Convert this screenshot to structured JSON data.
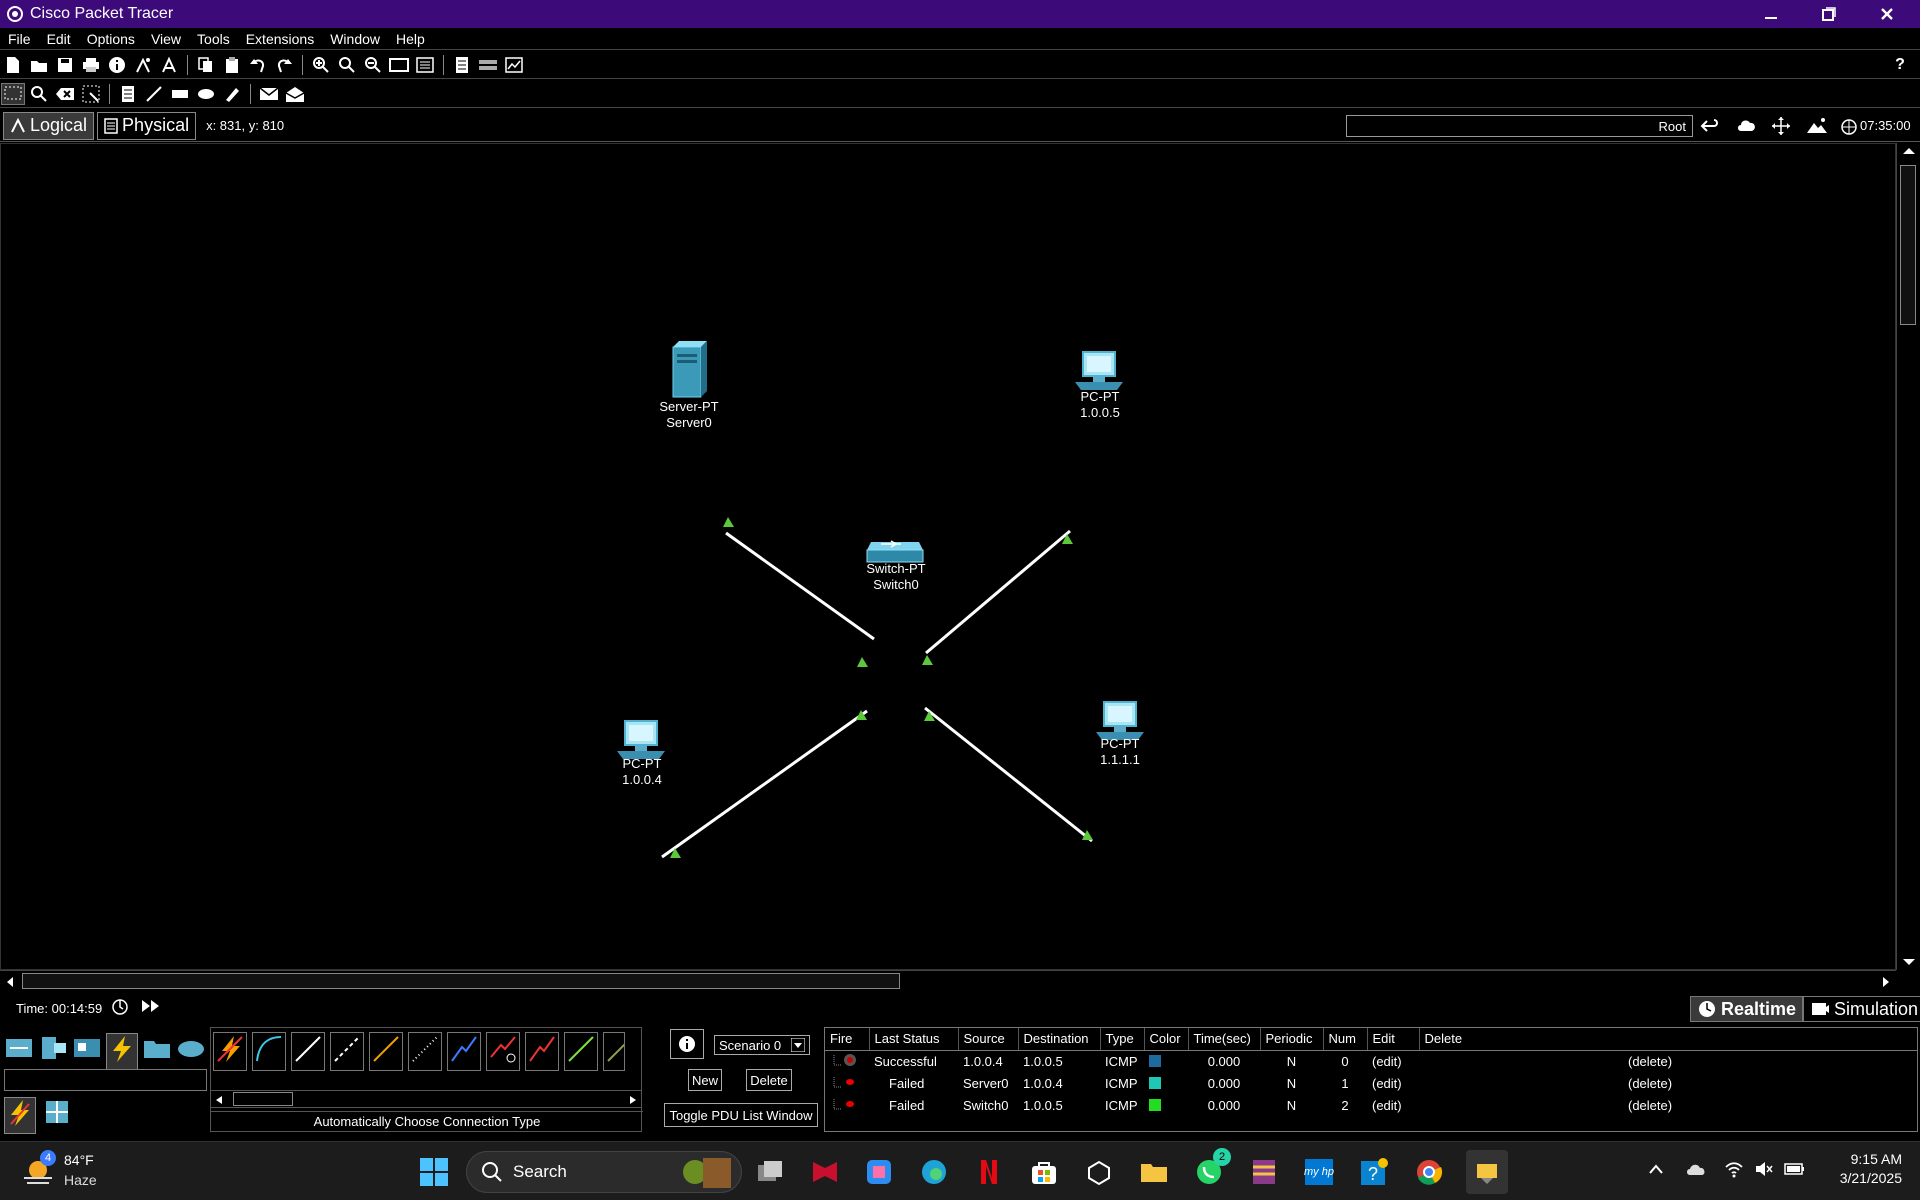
{
  "window": {
    "title": "Cisco Packet Tracer"
  },
  "menu": [
    "File",
    "Edit",
    "Options",
    "View",
    "Tools",
    "Extensions",
    "Window",
    "Help"
  ],
  "view": {
    "tabs": [
      "Logical",
      "Physical"
    ],
    "active_tab": "Logical",
    "coords": "x: 831, y: 810",
    "root_label": "Root",
    "clock": "07:35:00"
  },
  "topology": {
    "devices": [
      {
        "id": "server0",
        "type_label": "Server-PT",
        "name": "Server0",
        "icon": "server-icon"
      },
      {
        "id": "pc-top-right",
        "type_label": "PC-PT",
        "name": "1.0.0.5",
        "icon": "pc-icon"
      },
      {
        "id": "switch0",
        "type_label": "Switch-PT",
        "name": "Switch0",
        "icon": "switch-icon"
      },
      {
        "id": "pc-bottom-left",
        "type_label": "PC-PT",
        "name": "1.0.0.4",
        "icon": "pc-icon"
      },
      {
        "id": "pc-bottom-right",
        "type_label": "PC-PT",
        "name": "1.1.1.1",
        "icon": "pc-icon"
      }
    ],
    "link_color": "#ffffff",
    "port_light_color": "#5cc83c"
  },
  "sim": {
    "time": "Time: 00:14:59",
    "realtime_label": "Realtime",
    "simulation_label": "Simulation",
    "scenario": "Scenario 0",
    "new_label": "New",
    "delete_label": "Delete",
    "toggle_label": "Toggle PDU List Window",
    "conn_caption": "Automatically Choose Connection Type"
  },
  "pdu": {
    "headers": [
      "Fire",
      "Last Status",
      "Source",
      "Destination",
      "Type",
      "Color",
      "Time(sec)",
      "Periodic",
      "Num",
      "Edit",
      "Delete"
    ],
    "rows": [
      {
        "status": "Successful",
        "source": "1.0.0.4",
        "destination": "1.0.0.5",
        "type": "ICMP",
        "color": "#1c6a9e",
        "time": "0.000",
        "periodic": "N",
        "num": "0",
        "edit": "(edit)",
        "delete": "(delete)"
      },
      {
        "status": "Failed",
        "source": "Server0",
        "destination": "1.0.0.4",
        "type": "ICMP",
        "color": "#1fc7b5",
        "time": "0.000",
        "periodic": "N",
        "num": "1",
        "edit": "(edit)",
        "delete": "(delete)"
      },
      {
        "status": "Failed",
        "source": "Switch0",
        "destination": "1.0.0.5",
        "type": "ICMP",
        "color": "#22dd22",
        "time": "0.000",
        "periodic": "N",
        "num": "2",
        "edit": "(edit)",
        "delete": "(delete)"
      }
    ]
  },
  "taskbar": {
    "weather_temp": "84°F",
    "weather_desc": "Haze",
    "weather_badge": "4",
    "search_label": "Search",
    "whatsapp_badge": "2",
    "time": "9:15 AM",
    "date": "3/21/2025"
  }
}
